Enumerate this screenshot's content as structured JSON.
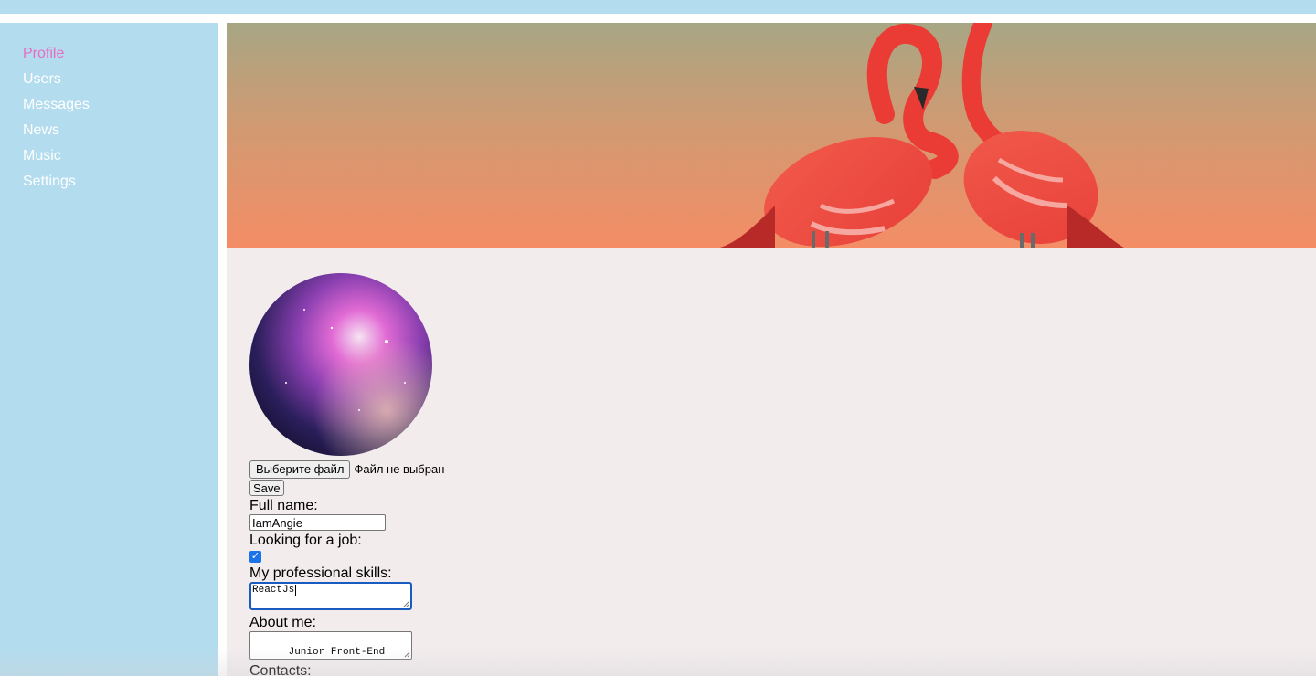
{
  "nav": {
    "items": [
      {
        "label": "Profile",
        "active": true
      },
      {
        "label": "Users"
      },
      {
        "label": "Messages"
      },
      {
        "label": "News"
      },
      {
        "label": "Music"
      },
      {
        "label": "Settings"
      }
    ]
  },
  "colors": {
    "header": "#b3dcee",
    "sidebar": "#b3dcee",
    "nav_active": "#e86cc4",
    "nav_text": "#ffffff",
    "content_bg": "#f2eced"
  },
  "banner": {
    "image": "flamingos-photo"
  },
  "avatar": {
    "image": "galaxy-nebula-photo"
  },
  "profile": {
    "file_button": "Выберите файл",
    "file_status": "Файл не выбран",
    "save_button": "Save",
    "full_name_label": "Full name:",
    "full_name_value": "IamAngie",
    "job_label": "Looking for a job:",
    "job_checked": true,
    "skills_label": "My professional skills:",
    "skills_value": "ReactJs",
    "about_label": "About me:",
    "about_value": "Junior Front-End developer",
    "contacts_label": "Contacts:"
  }
}
